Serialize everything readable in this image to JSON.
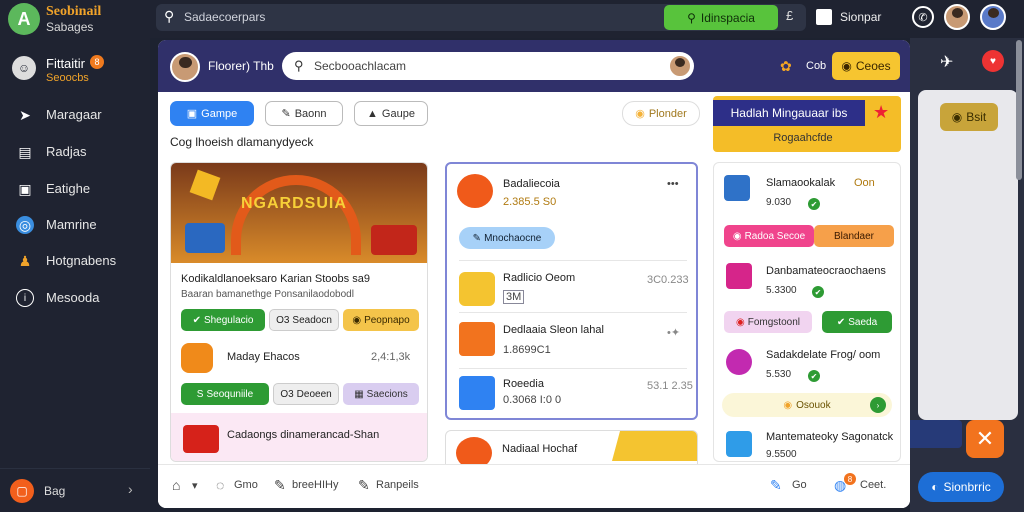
{
  "topbar": {
    "brand_title": "Seobinail",
    "brand_subtitle": "Sabages",
    "search_text": "Sadaecoerpars",
    "green_button": "Idinspacia",
    "doc_label": "Sionpar",
    "lb_label": "£"
  },
  "sidebar": {
    "profile_name": "Fittaitir",
    "profile_sub": "Seoocbs",
    "profile_badge": "8",
    "items": [
      {
        "label": "Maragaar",
        "icon": "send-icon"
      },
      {
        "label": "Radjas",
        "icon": "chart-icon"
      },
      {
        "label": "Eatighe",
        "icon": "image-icon"
      },
      {
        "label": "Mamrine",
        "icon": "globe-icon"
      },
      {
        "label": "Hotgnabens",
        "icon": "people-icon"
      },
      {
        "label": "Mesooda",
        "icon": "info-icon"
      }
    ],
    "bottom_label": "Bag"
  },
  "modal": {
    "user_name": "Floorer) Thb",
    "search_text": "Secbooachlacam",
    "gift_label": "Cob",
    "header_button": "Ceoes",
    "tabs": [
      "Gampe",
      "Baonn",
      "Gaupe"
    ],
    "right_tab": "Plonder",
    "subtitle": "Cog lhoeish dlamanydyeck",
    "promo_title": "Hadlah Mingauaar ibs",
    "promo_sub": "Rogaahcfde",
    "col1": {
      "hero_text": "NGARDSUIA",
      "line1": "Kodikaldlanoeksaro Karian Stoobs sa9",
      "line2": "Baaran bamanethge Ponsanilaodobodl",
      "pills1": [
        "Shegulacio",
        "Seadocn",
        "Peopnapo"
      ],
      "pills1_prefix": [
        "",
        "O3",
        ""
      ],
      "item": "Maday Ehacos",
      "item_value": "2,4:1,3k",
      "pills2": [
        "Seoquniile",
        "Deoeen",
        "Saecions"
      ],
      "pills2_prefix": [
        "S",
        "O3",
        ""
      ],
      "last": "Cadaongs dinamerancad-Shan"
    },
    "col2": {
      "items": [
        {
          "title": "Badaliecoia",
          "value": "2.385.5 S0",
          "extra": "•••"
        },
        {
          "title": "Radlicio Oeom",
          "value": "3M",
          "extra": "3C0.233"
        },
        {
          "title": "Dedlaaia Sleon lahal",
          "value": "1.8699C1",
          "extra": "•✦"
        },
        {
          "title": "Roeedia",
          "value": "0.3068 I:0 0",
          "extra": "53.1 2.35"
        }
      ],
      "blue_pill": "Mnochaocne",
      "bottom": "Nadiaal Hochaf"
    },
    "col3": {
      "items": [
        {
          "title": "Slamaookalak",
          "value": "9.030",
          "extra": "Oon"
        },
        {
          "title": "Danbamateocraochaens",
          "value": "5.3300",
          "extra": ""
        },
        {
          "title": "Sadakdelate Frog/ oom",
          "value": "5.530",
          "extra": ""
        },
        {
          "title": "Mantemateoky Sagonatck",
          "value": "9.5500",
          "extra": ""
        }
      ],
      "pill_pink": "Radoa Secoe",
      "pill_orange": "Blandaer",
      "pill_lilac": "Fomgstoonl",
      "pill_green": "Saeda",
      "yellow_pill": "Osouok"
    },
    "footer": {
      "items": [
        "Gmo",
        "breeHIHy",
        "Ranpeils"
      ],
      "right1": "Go",
      "right2": "Ceet.",
      "right2_badge": "8"
    }
  },
  "background": {
    "pill": "Bsit",
    "blue_pill": "Sionbrric",
    "close": "✕"
  }
}
